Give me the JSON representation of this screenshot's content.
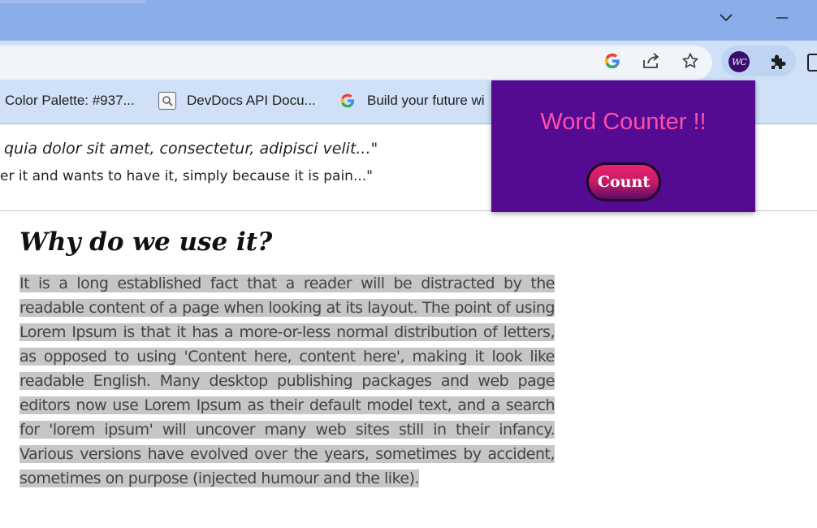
{
  "titlebar": {
    "tab_search_icon": "chevron-down-icon",
    "minimize_icon": "minimize-icon"
  },
  "toolbar": {
    "icons": [
      "google-icon",
      "share-icon",
      "bookmark-star-icon",
      "word-counter-extension-icon",
      "extensions-puzzle-icon",
      "side-panel-icon"
    ],
    "extension_badge_text": "WC"
  },
  "bookmarks": [
    {
      "label": "Color Palette: #937...",
      "icon": "color-palette-favicon"
    },
    {
      "label": "DevDocs API Docu...",
      "icon": "devdocs-favicon"
    },
    {
      "label": "Build your future wi",
      "icon": "google-favicon"
    }
  ],
  "page": {
    "quote_line_1": "quia dolor sit amet, consectetur, adipisci velit...\"",
    "quote_line_2": "er it and wants to have it, simply because it is pain...\"",
    "heading": "Why do we use it?",
    "paragraph": "It is a long established fact that a reader will be distracted by the readable content of a page when looking at its layout. The point of using Lorem Ipsum is that it has a more-or-less normal distribution of letters, as opposed to using 'Content here, content here', making it look like readable English. Many desktop publishing packages and web page editors now use Lorem Ipsum as their default model text, and a search for 'lorem ipsum' will uncover many web sites still in their infancy. Various versions have evolved over the years, sometimes by accident, sometimes on purpose (injected humour and the like)."
  },
  "popup": {
    "title": "Word Counter !!",
    "count_button": "Count"
  },
  "colors": {
    "titlebar": "#8aaeea",
    "toolbar": "#cfe0f7",
    "popup_bg": "#540b92",
    "popup_title": "#ff4fa8",
    "button_accent": "#e8246e",
    "selection": "#c6c6c6"
  }
}
